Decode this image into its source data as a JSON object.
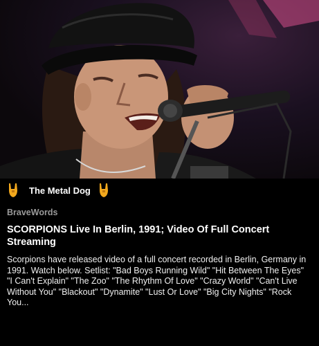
{
  "hero": {
    "alt": "Singer in black leather cap singing into a microphone on stage"
  },
  "source": {
    "name": "The Metal Dog",
    "icon": "rock-horns-icon",
    "accent": "#f2a81d"
  },
  "article": {
    "publisher": "BraveWords",
    "headline": "SCORPIONS Live In Berlin, 1991; Video Of Full Concert Streaming",
    "summary": "Scorpions have released video of a full concert recorded in Berlin, Germany in 1991. Watch below. Setlist: \"Bad Boys Running Wild\" \"Hit Between The Eyes\" \"I Can't Explain\" \"The Zoo\" \"The Rhythm Of Love\" \"Crazy World\" \"Can't Live Without You\" \"Blackout\" \"Dynamite\" \"Lust Or Love\" \"Big City Nights\" \"Rock You..."
  }
}
